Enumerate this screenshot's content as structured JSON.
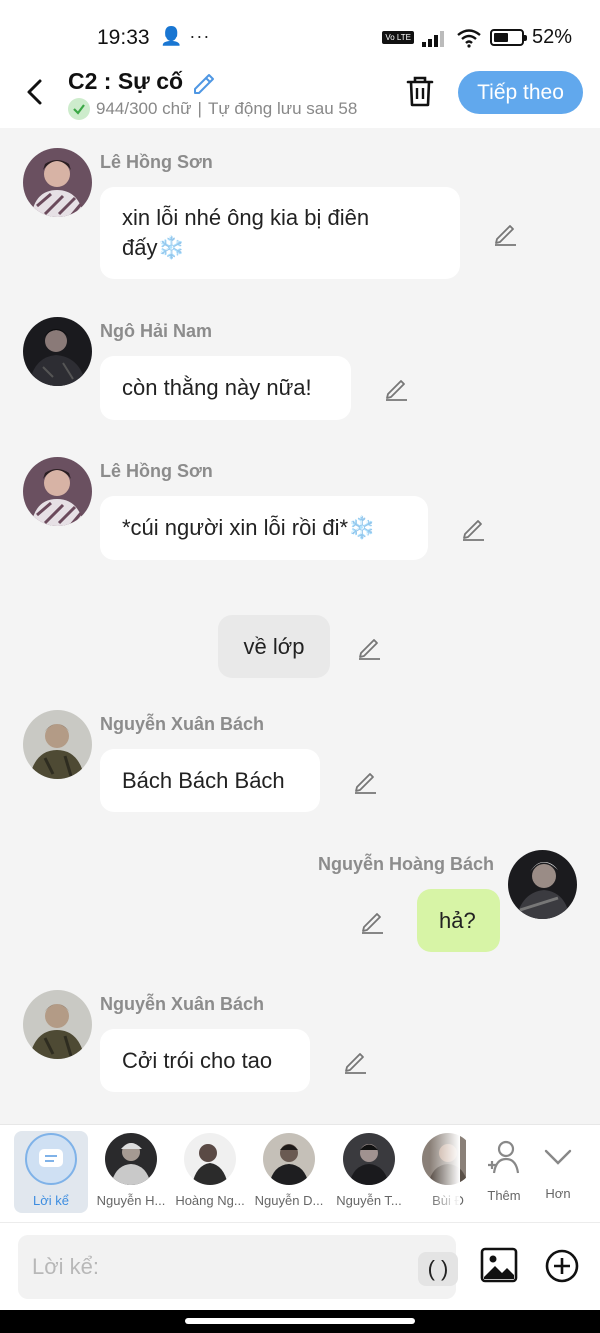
{
  "status_bar": {
    "time": "19:33",
    "left_icons": "👤 ···",
    "volte": "Vo LTE",
    "battery": "52%"
  },
  "header": {
    "title": "C2 : Sự cố",
    "word_count": "944/300 chữ",
    "autosave": "Tự động lưu sau 58",
    "next_label": "Tiếp theo"
  },
  "messages": [
    {
      "sender": "Lê Hồng Sơn",
      "text": "xin lỗi nhé ông kia bị điên đấy❄️",
      "side": "left"
    },
    {
      "sender": "Ngô Hải Nam",
      "text": "còn thằng này nữa!",
      "side": "left"
    },
    {
      "sender": "Lê Hồng Sơn",
      "text": "*cúi người xin lỗi rồi đi*❄️",
      "side": "left"
    },
    {
      "sender": "",
      "text": "về lớp",
      "side": "narration"
    },
    {
      "sender": "Nguyễn Xuân Bách",
      "text": "Bách Bách Bách",
      "side": "left"
    },
    {
      "sender": "Nguyễn Hoàng Bách",
      "text": "hả?",
      "side": "right"
    },
    {
      "sender": "Nguyễn Xuân Bách",
      "text": "Cởi trói cho tao",
      "side": "left"
    }
  ],
  "character_bar": {
    "narration_label": "Lời kể",
    "characters": [
      "Nguyễn H...",
      "Hoàng Ng...",
      "Nguyễn D...",
      "Nguyễn T...",
      "Bùi Đ"
    ],
    "add_label": "Thêm",
    "more_label": "Hơn"
  },
  "input": {
    "placeholder": "Lời kể:",
    "paren_label": "( )"
  },
  "colors": {
    "accent": "#61a8ed",
    "own_bubble": "#d7f4a6",
    "background": "#f4f4f4"
  }
}
